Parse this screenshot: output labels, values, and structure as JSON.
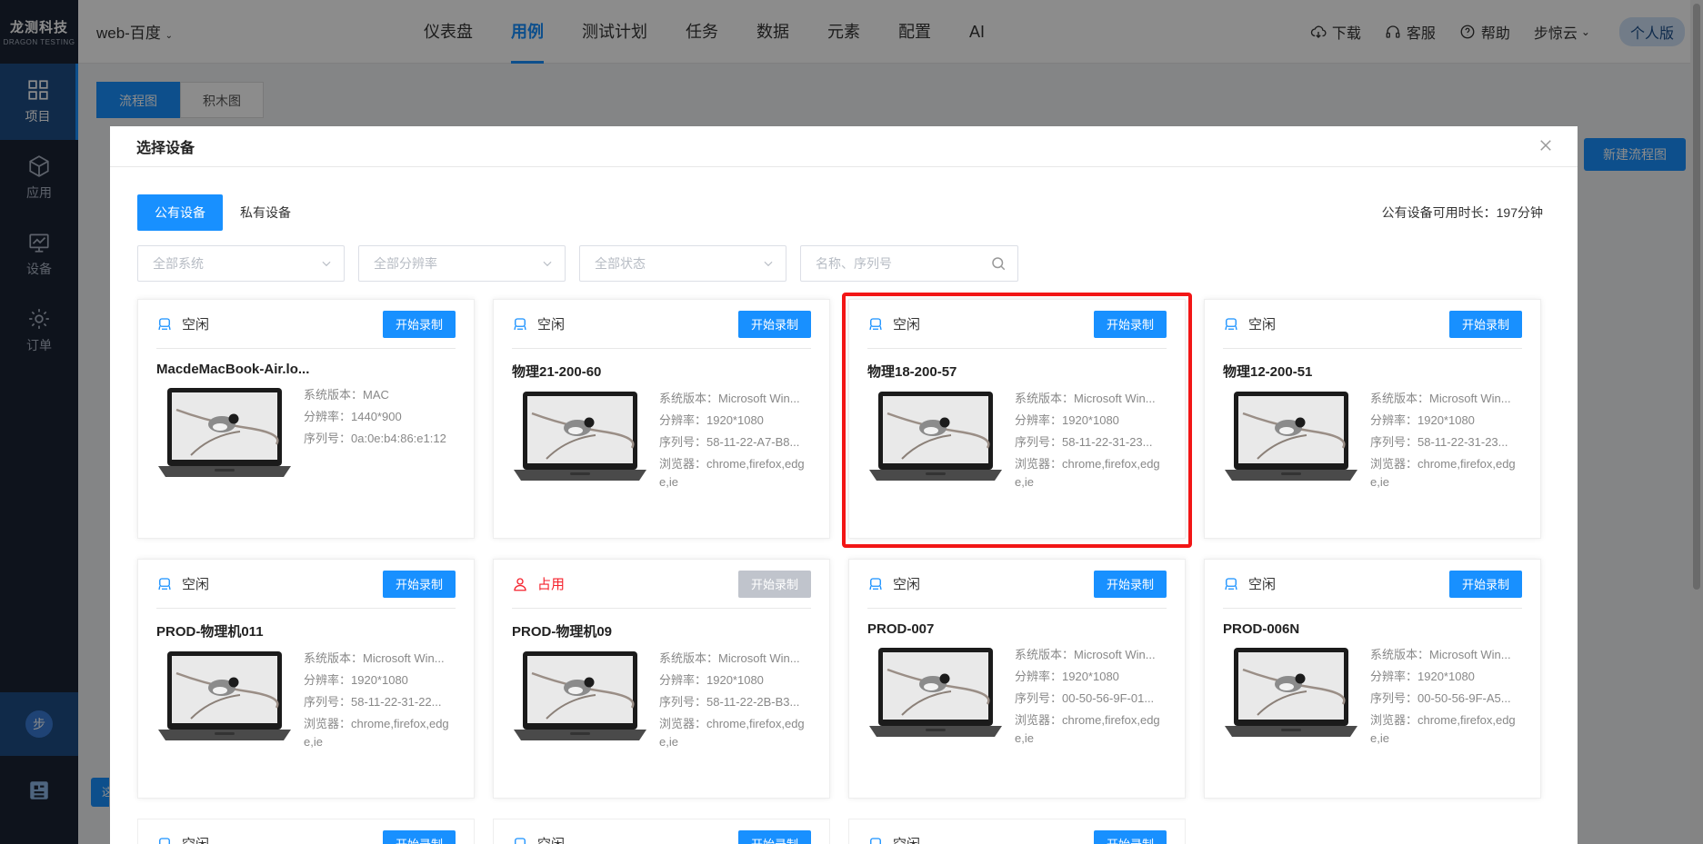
{
  "sidebar": {
    "logo_main": "龙测科技",
    "logo_sub": "DRAGON TESTING",
    "items": [
      {
        "label": "项目",
        "icon": "grid-icon"
      },
      {
        "label": "应用",
        "icon": "cube-icon"
      },
      {
        "label": "设备",
        "icon": "monitor-icon"
      },
      {
        "label": "订单",
        "icon": "gear-icon"
      }
    ],
    "user_initial": "步",
    "tip_text": "这"
  },
  "header": {
    "project": "web-百度",
    "nav": [
      "仪表盘",
      "用例",
      "测试计划",
      "任务",
      "数据",
      "元素",
      "配置",
      "AI"
    ],
    "active_nav": "用例",
    "download": "下载",
    "service": "客服",
    "help": "帮助",
    "user": "步惊云",
    "edition": "个人版"
  },
  "page": {
    "tabs": [
      "流程图",
      "积木图"
    ],
    "new_flow": "新建流程图"
  },
  "modal": {
    "title": "选择设备",
    "device_tabs": [
      "公有设备",
      "私有设备"
    ],
    "available_label": "公有设备可用时长：",
    "available_value": "197分钟",
    "filters": {
      "system": "全部系统",
      "resolution": "全部分辨率",
      "status": "全部状态",
      "search_placeholder": "名称、序列号"
    },
    "labels": {
      "version": "系统版本：",
      "resolution": "分辨率：",
      "serial": "序列号：",
      "browser": "浏览器："
    },
    "record_label": "开始录制",
    "devices": [
      {
        "status": "空闲",
        "busy": false,
        "name": "MacdeMacBook-Air.lo...",
        "version": "MAC",
        "resolution": "1440*900",
        "serial": "0a:0e:b4:86:e1:12",
        "browser": ""
      },
      {
        "status": "空闲",
        "busy": false,
        "name": "物理21-200-60",
        "version": "Microsoft Win...",
        "resolution": "1920*1080",
        "serial": "58-11-22-A7-B8...",
        "browser": "chrome,firefox,edge,ie"
      },
      {
        "status": "空闲",
        "busy": false,
        "name": "物理18-200-57",
        "version": "Microsoft Win...",
        "resolution": "1920*1080",
        "serial": "58-11-22-31-23...",
        "browser": "chrome,firefox,edge,ie",
        "highlight": true
      },
      {
        "status": "空闲",
        "busy": false,
        "name": "物理12-200-51",
        "version": "Microsoft Win...",
        "resolution": "1920*1080",
        "serial": "58-11-22-31-23...",
        "browser": "chrome,firefox,edge,ie"
      },
      {
        "status": "空闲",
        "busy": false,
        "name": "PROD-物理机011",
        "version": "Microsoft Win...",
        "resolution": "1920*1080",
        "serial": "58-11-22-31-22...",
        "browser": "chrome,firefox,edge,ie"
      },
      {
        "status": "占用",
        "busy": true,
        "name": "PROD-物理机09",
        "version": "Microsoft Win...",
        "resolution": "1920*1080",
        "serial": "58-11-22-2B-B3...",
        "browser": "chrome,firefox,edge,ie"
      },
      {
        "status": "空闲",
        "busy": false,
        "name": "PROD-007",
        "version": "Microsoft Win...",
        "resolution": "1920*1080",
        "serial": "00-50-56-9F-01...",
        "browser": "chrome,firefox,edge,ie"
      },
      {
        "status": "空闲",
        "busy": false,
        "name": "PROD-006N",
        "version": "Microsoft Win...",
        "resolution": "1920*1080",
        "serial": "00-50-56-9F-A5...",
        "browser": "chrome,firefox,edge,ie"
      },
      {
        "status": "空闲",
        "busy": false,
        "partial": true
      },
      {
        "status": "空闲",
        "busy": false,
        "partial": true
      },
      {
        "status": "空闲",
        "busy": false,
        "partial": true
      }
    ]
  },
  "colors": {
    "primary": "#1890ff",
    "sidebar_bg": "#1a2333",
    "busy": "#f5222d",
    "highlight": "#f21616"
  }
}
